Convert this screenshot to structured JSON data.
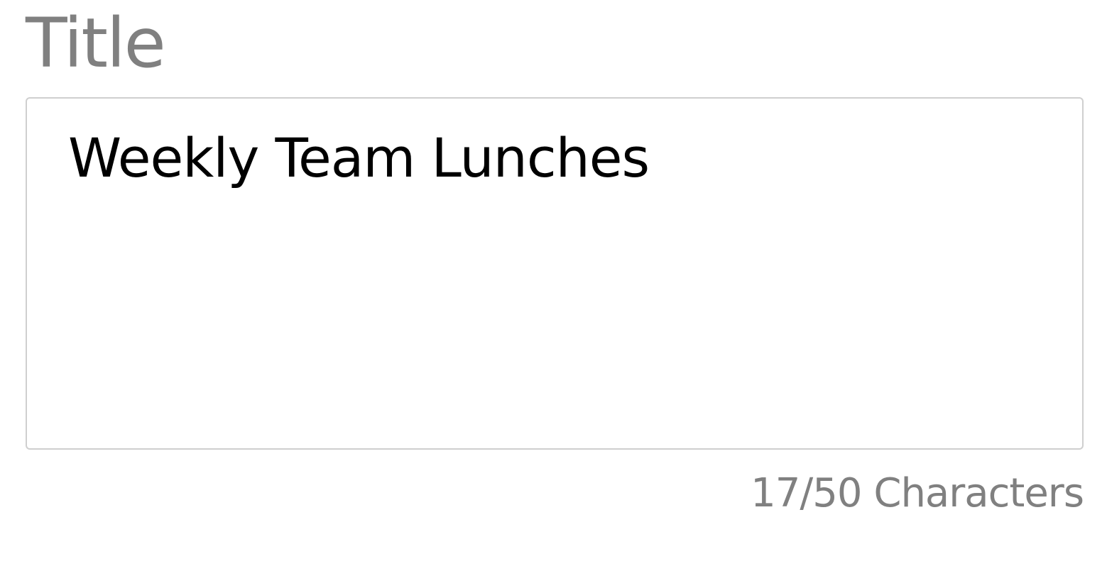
{
  "title_field": {
    "label": "Title",
    "value": "Weekly Team Lunches",
    "counter": "17/50 Characters"
  },
  "colors": {
    "label": "#808080",
    "text": "#000000",
    "border": "#cfcfcf",
    "background": "#ffffff"
  }
}
